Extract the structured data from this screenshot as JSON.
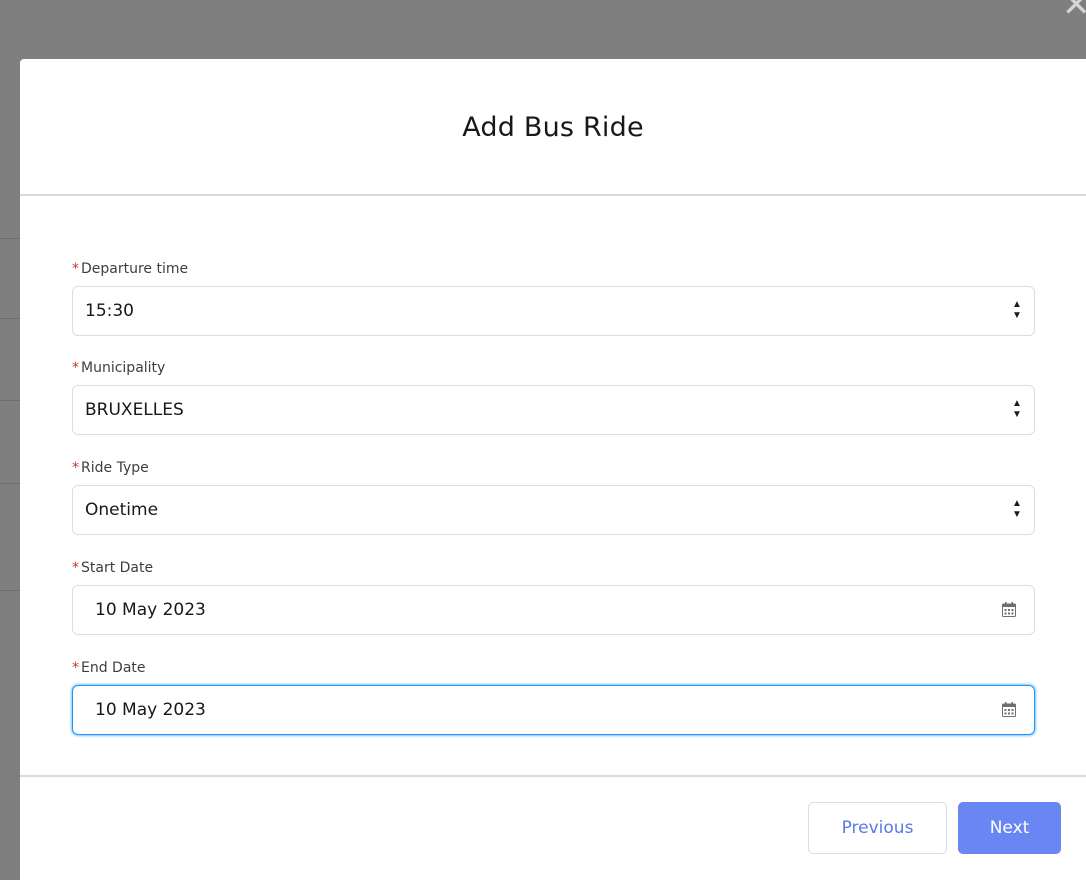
{
  "modal": {
    "title": "Add Bus Ride",
    "close_icon": "close-icon"
  },
  "fields": {
    "departure_time": {
      "label": "Departure time",
      "required": "*",
      "value": "15:30"
    },
    "municipality": {
      "label": "Municipality",
      "required": "*",
      "value": "BRUXELLES"
    },
    "ride_type": {
      "label": "Ride Type",
      "required": "*",
      "value": "Onetime"
    },
    "start_date": {
      "label": "Start Date",
      "required": "*",
      "value": "10 May 2023"
    },
    "end_date": {
      "label": "End Date",
      "required": "*",
      "value": "10 May 2023"
    }
  },
  "footer": {
    "previous_label": "Previous",
    "next_label": "Next"
  },
  "colors": {
    "accent": "#6a86f3",
    "required": "#c23934",
    "focus": "#1b96ff",
    "backdrop": "#7f7f7f"
  }
}
